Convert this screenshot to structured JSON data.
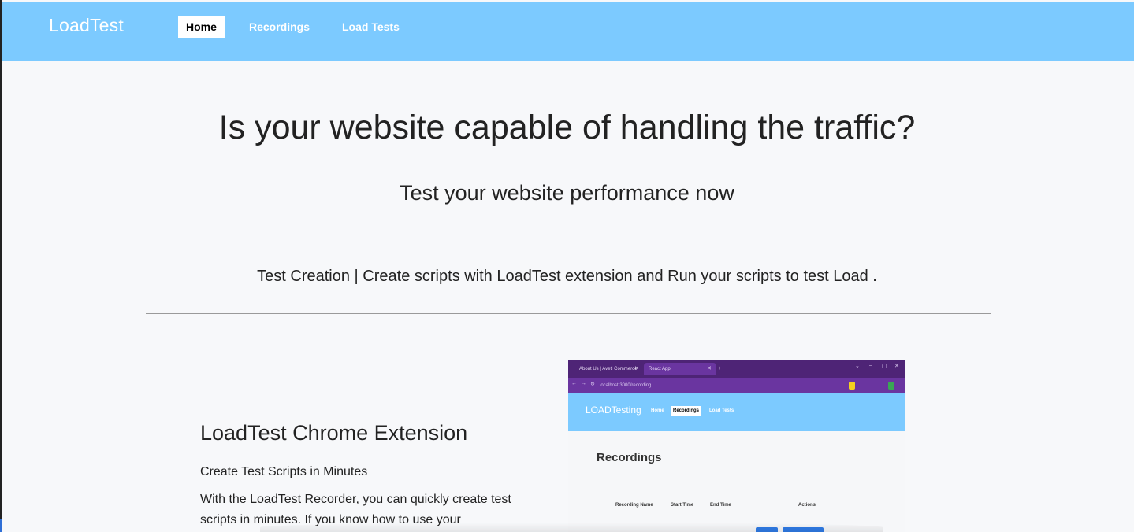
{
  "navbar": {
    "brand": "LoadTest",
    "items": [
      {
        "label": "Home",
        "active": true
      },
      {
        "label": "Recordings",
        "active": false
      },
      {
        "label": "Load Tests",
        "active": false
      }
    ],
    "background": "#7ccaff"
  },
  "hero": {
    "title": "Is your website capable of handling the traffic?",
    "subtitle": "Test your website performance now",
    "tagline": "Test Creation | Create scripts with LoadTest extension and Run your scripts to test Load ."
  },
  "feature": {
    "title": "LoadTest Chrome Extension",
    "subtitle": "Create Test Scripts in Minutes",
    "body": "With the LoadTest Recorder, you can quickly create test scripts in minutes. If you know how to use your"
  },
  "screenshot": {
    "tabs": [
      {
        "label": "About Us | Aveti Commerce",
        "active": false
      },
      {
        "label": "React App",
        "active": true
      }
    ],
    "url": "localhost:3000/recording",
    "brand": "LOADTesting",
    "nav": [
      {
        "label": "Home",
        "active": false
      },
      {
        "label": "Recordings",
        "active": true
      },
      {
        "label": "Load Tests",
        "active": false
      }
    ],
    "heading": "Recordings",
    "columns": [
      "Recording Name",
      "Start Time",
      "End Time",
      "Actions"
    ]
  }
}
